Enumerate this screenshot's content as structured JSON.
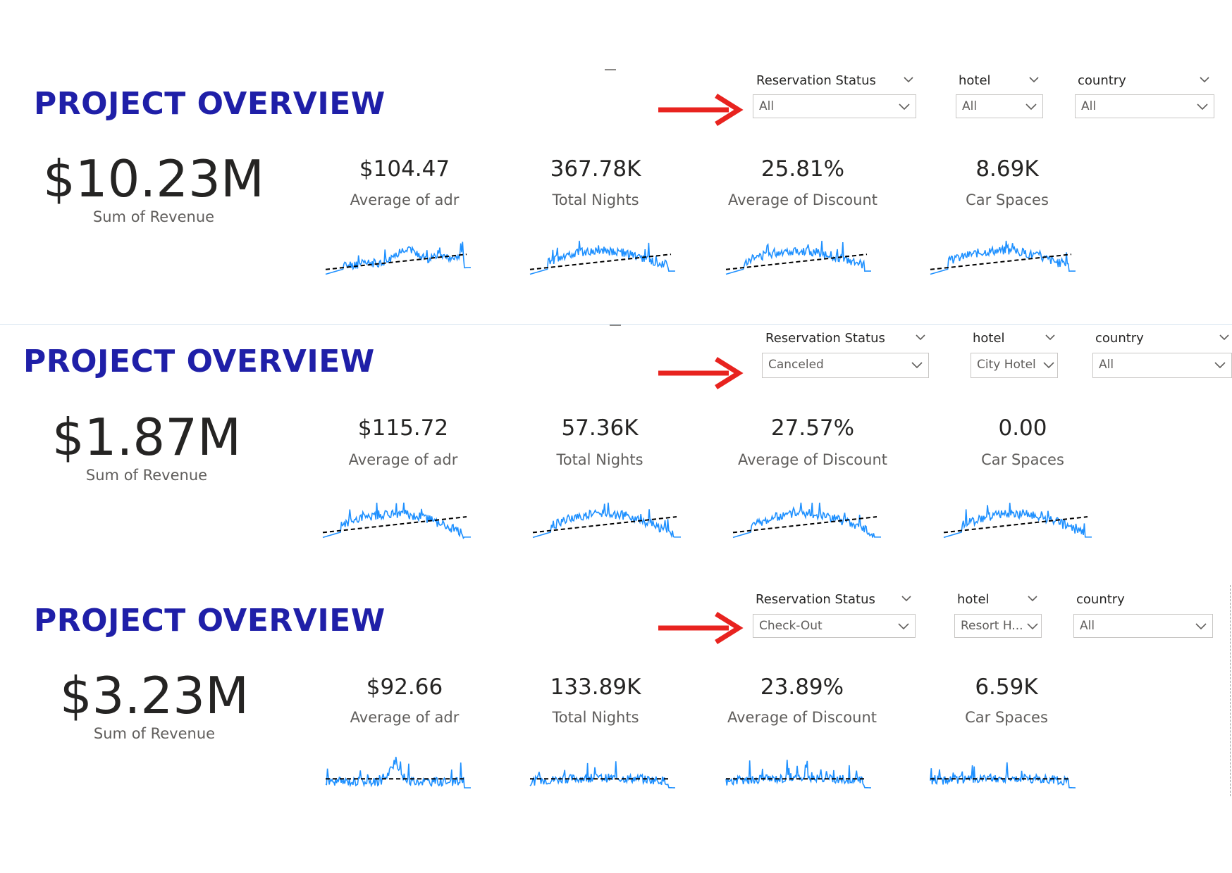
{
  "panels": [
    {
      "title": "PROJECT OVERVIEW",
      "revenue": {
        "value": "$10.23M",
        "label": "Sum of Revenue"
      },
      "kpis": [
        {
          "value": "$104.47",
          "label": "Average of adr"
        },
        {
          "value": "367.78K",
          "label": "Total Nights"
        },
        {
          "value": "25.81%",
          "label": "Average of Discount"
        },
        {
          "value": "8.69K",
          "label": "Car Spaces"
        }
      ],
      "slicers": [
        {
          "header": "Reservation Status",
          "value": "All"
        },
        {
          "header": "hotel",
          "value": "All"
        },
        {
          "header": "country",
          "value": "All"
        }
      ]
    },
    {
      "title": "PROJECT OVERVIEW",
      "revenue": {
        "value": "$1.87M",
        "label": "Sum of Revenue"
      },
      "kpis": [
        {
          "value": "$115.72",
          "label": "Average of adr"
        },
        {
          "value": "57.36K",
          "label": "Total Nights"
        },
        {
          "value": "27.57%",
          "label": "Average of Discount"
        },
        {
          "value": "0.00",
          "label": "Car Spaces"
        }
      ],
      "slicers": [
        {
          "header": "Reservation Status",
          "value": "Canceled"
        },
        {
          "header": "hotel",
          "value": "City Hotel"
        },
        {
          "header": "country",
          "value": "All"
        }
      ]
    },
    {
      "title": "PROJECT OVERVIEW",
      "revenue": {
        "value": "$3.23M",
        "label": "Sum of Revenue"
      },
      "kpis": [
        {
          "value": "$92.66",
          "label": "Average of adr"
        },
        {
          "value": "133.89K",
          "label": "Total Nights"
        },
        {
          "value": "23.89%",
          "label": "Average of Discount"
        },
        {
          "value": "6.59K",
          "label": "Car Spaces"
        }
      ],
      "slicers": [
        {
          "header": "Reservation Status",
          "value": "Check-Out"
        },
        {
          "header": "hotel",
          "value": "Resort H..."
        },
        {
          "header": "country",
          "value": "All"
        }
      ]
    }
  ],
  "colors": {
    "title": "#1f1fa8",
    "sparkline": "#1e90ff",
    "trendline": "#000000",
    "arrow": "#e8231f"
  },
  "icons": {
    "slicer_dropdown": "chevron-down-icon",
    "annotation": "red-arrow-icon"
  }
}
